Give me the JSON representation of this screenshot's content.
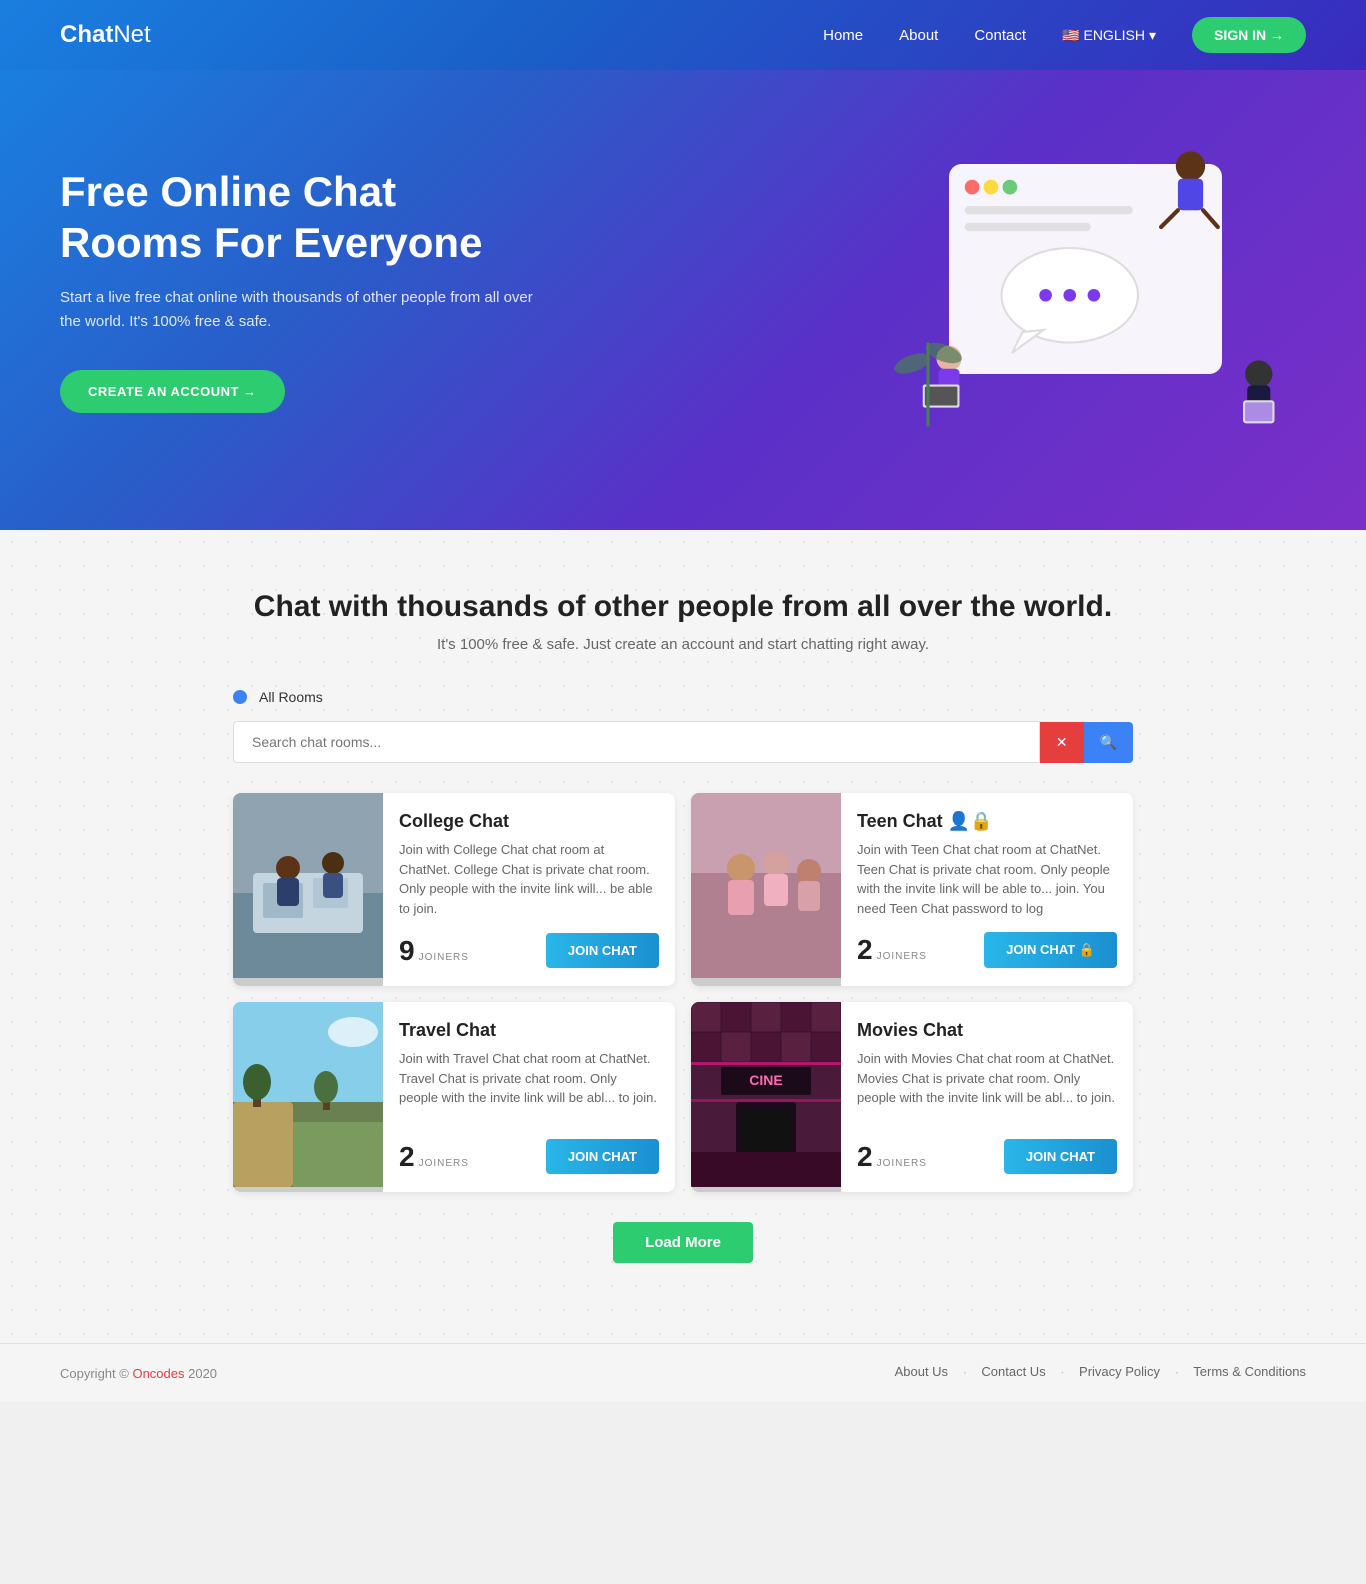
{
  "brand": {
    "chat": "Chat",
    "net": "Net"
  },
  "navbar": {
    "links": [
      {
        "label": "Home",
        "href": "#"
      },
      {
        "label": "About",
        "href": "#"
      },
      {
        "label": "Contact",
        "href": "#"
      }
    ],
    "language": "ENGLISH",
    "signin": "SIGN IN →"
  },
  "hero": {
    "title": "Free Online Chat Rooms For Everyone",
    "subtitle": "Start a live free chat online with thousands of other people from all over the world. It's 100% free & safe.",
    "cta": "CREATE AN ACCOUNT →"
  },
  "section": {
    "title": "Chat with thousands of other people from all over the world.",
    "subtitle": "It's 100% free &amp; safe. Just create an account and start chatting right away."
  },
  "filter": {
    "label": "All Rooms"
  },
  "search": {
    "placeholder": "Search chat rooms...",
    "clear": "✕",
    "go": "🔍"
  },
  "rooms": [
    {
      "name": "College Chat",
      "icons": "",
      "description": "Join with College Chat chat room at ChatNet. College Chat is private chat room. Only people with the invite link will... be able to join.",
      "joiners": 9,
      "join_label": "JOIN CHAT",
      "private": false,
      "img_class": "img-college"
    },
    {
      "name": "Teen Chat",
      "icons": "🔒",
      "description": "Join with Teen Chat chat room at ChatNet. Teen Chat is private chat room. Only people with the invite link will be able to... join. You need Teen Chat password to log",
      "joiners": 2,
      "join_label": "JOIN CHAT 🔒",
      "private": true,
      "img_class": "img-teen"
    },
    {
      "name": "Travel Chat",
      "icons": "",
      "description": "Join with Travel Chat chat room at ChatNet. Travel Chat is private chat room. Only people with the invite link will be abl... to join.",
      "joiners": 2,
      "join_label": "JOIN CHAT",
      "private": false,
      "img_class": "img-travel"
    },
    {
      "name": "Movies Chat",
      "icons": "",
      "description": "Join with Movies Chat chat room at ChatNet. Movies Chat is private chat room. Only people with the invite link will be abl... to join.",
      "joiners": 2,
      "join_label": "JOIN CHAT",
      "private": false,
      "img_class": "img-movies"
    }
  ],
  "load_more": "Load More",
  "footer": {
    "copy": "Copyright © Oncodes 2020",
    "links": [
      {
        "label": "About Us"
      },
      {
        "label": "Contact Us"
      },
      {
        "label": "Privacy Policy"
      },
      {
        "label": "Terms & Conditions"
      }
    ]
  }
}
